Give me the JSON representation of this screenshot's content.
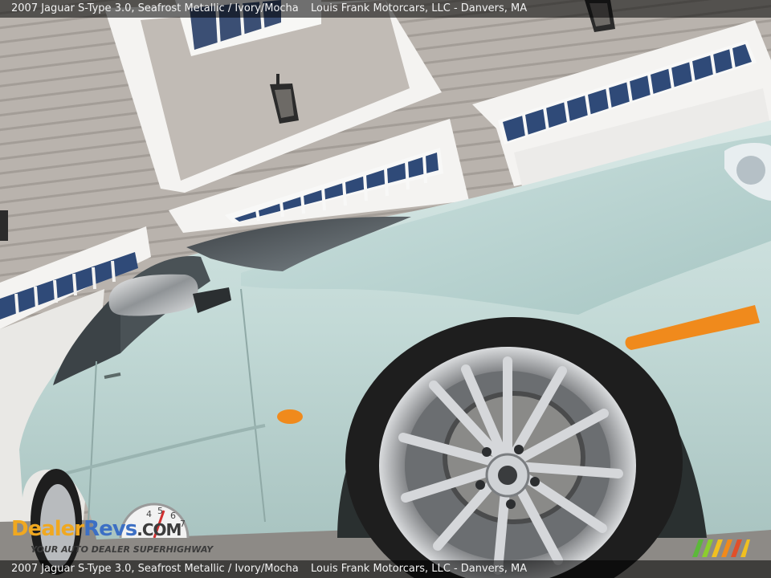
{
  "caption": {
    "vehicle": "2007 Jaguar S-Type 3.0,  Seafrost Metallic / Ivory/Mocha",
    "dealer": "Louis Frank Motorcars, LLC - Danvers, MA"
  },
  "watermark": {
    "name_part1": "Dealer",
    "name_part2": "Revs",
    "name_part3": ".COM",
    "tagline": "YOUR AUTO DEALER SUPERHIGHWAY"
  },
  "colors": {
    "car_body": "#c5dbd8",
    "siding": "#b9b3ad",
    "trim": "#f5f5f3",
    "turn_signal": "#f08a1c",
    "tire": "#1e1e1e"
  }
}
